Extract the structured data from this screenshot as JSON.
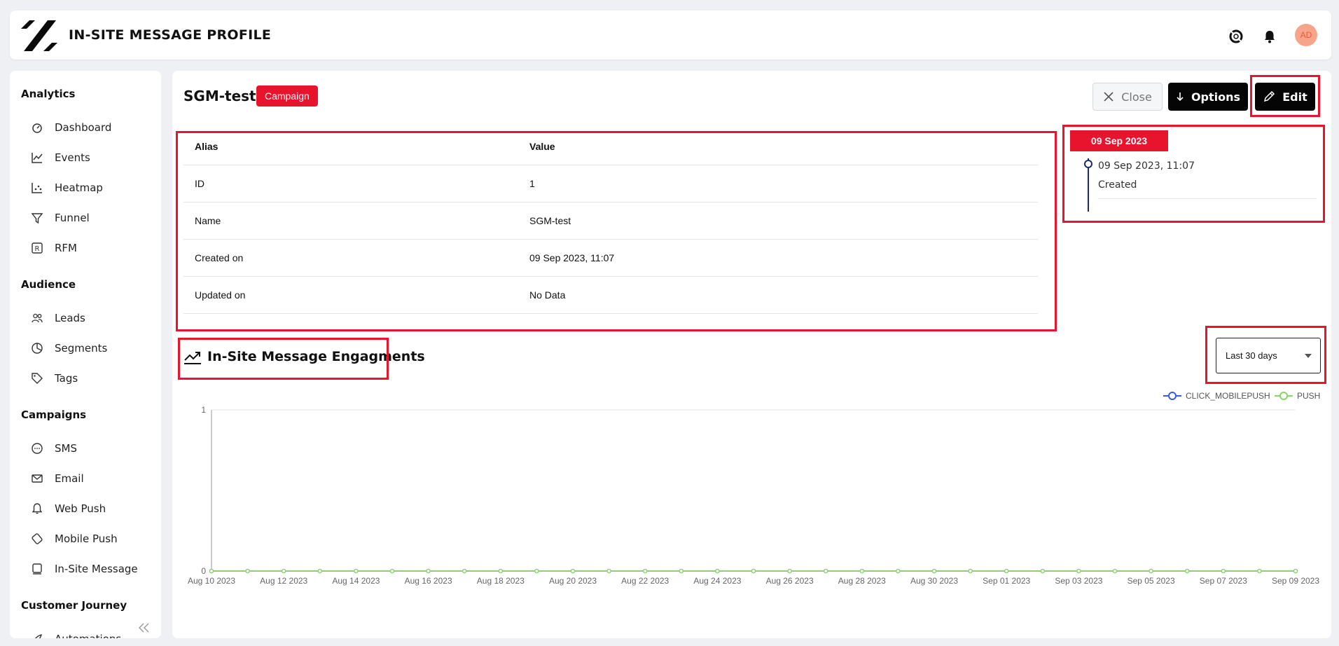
{
  "header": {
    "title": "IN-SITE MESSAGE PROFILE",
    "avatar_initials": "AD"
  },
  "sidebar": {
    "sections": [
      {
        "label": "Analytics",
        "items": [
          {
            "label": "Dashboard",
            "icon": "dashboard-icon"
          },
          {
            "label": "Events",
            "icon": "line-chart-icon"
          },
          {
            "label": "Heatmap",
            "icon": "scatter-icon"
          },
          {
            "label": "Funnel",
            "icon": "funnel-icon"
          },
          {
            "label": "RFM",
            "icon": "rfm-icon"
          }
        ]
      },
      {
        "label": "Audience",
        "items": [
          {
            "label": "Leads",
            "icon": "users-icon"
          },
          {
            "label": "Segments",
            "icon": "pie-icon"
          },
          {
            "label": "Tags",
            "icon": "tag-icon"
          }
        ]
      },
      {
        "label": "Campaigns",
        "items": [
          {
            "label": "SMS",
            "icon": "chat-icon"
          },
          {
            "label": "Email",
            "icon": "mail-icon"
          },
          {
            "label": "Web Push",
            "icon": "bell-icon"
          },
          {
            "label": "Mobile Push",
            "icon": "mobile-push-icon"
          },
          {
            "label": "In-Site Message",
            "icon": "message-icon"
          }
        ]
      },
      {
        "label": "Customer Journey",
        "items": [
          {
            "label": "Automations",
            "icon": "rocket-icon"
          }
        ]
      }
    ]
  },
  "page": {
    "title": "SGM-test",
    "badge": "Campaign"
  },
  "actions": {
    "close": "Close",
    "options": "Options",
    "edit": "Edit"
  },
  "details": {
    "headers": [
      "Alias",
      "Value"
    ],
    "rows": [
      [
        "ID",
        "1"
      ],
      [
        "Name",
        "SGM-test"
      ],
      [
        "Created on",
        "09 Sep 2023, 11:07"
      ],
      [
        "Updated on",
        "No Data"
      ]
    ]
  },
  "timeline": {
    "date": "09 Sep 2023",
    "time": "09 Sep 2023, 11:07",
    "status": "Created"
  },
  "engagement": {
    "title": "In-Site Message Engagments",
    "range": "Last 30 days"
  },
  "colors": {
    "accent": "#e8132d",
    "click_series": "#3b5bdb",
    "push_series": "#8cd16b"
  },
  "chart_data": {
    "type": "line",
    "x": [
      "Aug 10 2023",
      "Aug 11 2023",
      "Aug 12 2023",
      "Aug 13 2023",
      "Aug 14 2023",
      "Aug 15 2023",
      "Aug 16 2023",
      "Aug 17 2023",
      "Aug 18 2023",
      "Aug 19 2023",
      "Aug 20 2023",
      "Aug 21 2023",
      "Aug 22 2023",
      "Aug 23 2023",
      "Aug 24 2023",
      "Aug 25 2023",
      "Aug 26 2023",
      "Aug 27 2023",
      "Aug 28 2023",
      "Aug 29 2023",
      "Aug 30 2023",
      "Aug 31 2023",
      "Sep 01 2023",
      "Sep 02 2023",
      "Sep 03 2023",
      "Sep 04 2023",
      "Sep 05 2023",
      "Sep 06 2023",
      "Sep 07 2023",
      "Sep 08 2023",
      "Sep 09 2023"
    ],
    "x_tick_labels": [
      "Aug 10 2023",
      "Aug 12 2023",
      "Aug 14 2023",
      "Aug 16 2023",
      "Aug 18 2023",
      "Aug 20 2023",
      "Aug 22 2023",
      "Aug 24 2023",
      "Aug 26 2023",
      "Aug 28 2023",
      "Aug 30 2023",
      "Sep 01 2023",
      "Sep 03 2023",
      "Sep 05 2023",
      "Sep 07 2023",
      "Sep 09 2023"
    ],
    "series": [
      {
        "name": "CLICK_MOBILEPUSH",
        "values": [
          0,
          0,
          0,
          0,
          0,
          0,
          0,
          0,
          0,
          0,
          0,
          0,
          0,
          0,
          0,
          0,
          0,
          0,
          0,
          0,
          0,
          0,
          0,
          0,
          0,
          0,
          0,
          0,
          0,
          0,
          0
        ]
      },
      {
        "name": "PUSH",
        "values": [
          0,
          0,
          0,
          0,
          0,
          0,
          0,
          0,
          0,
          0,
          0,
          0,
          0,
          0,
          0,
          0,
          0,
          0,
          0,
          0,
          0,
          0,
          0,
          0,
          0,
          0,
          0,
          0,
          0,
          0,
          0
        ]
      }
    ],
    "ylim": [
      0,
      1
    ],
    "y_tick_labels": [
      "0",
      "1"
    ],
    "legend": "top-right",
    "grid": true
  }
}
